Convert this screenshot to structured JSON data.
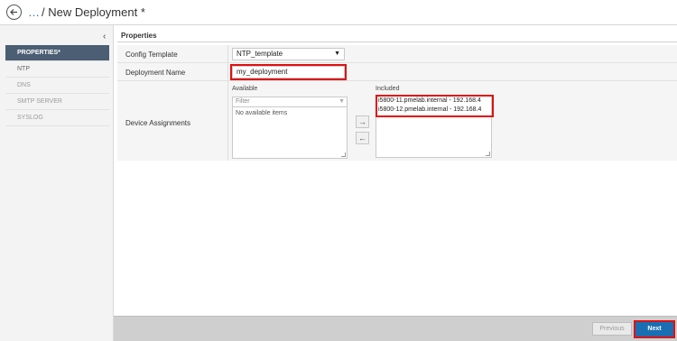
{
  "header": {
    "ellipsis": "…",
    "title": "/ New Deployment *"
  },
  "sidebar": {
    "collapse_glyph": "‹",
    "items": [
      {
        "label": "PROPERTIES*"
      },
      {
        "label": "NTP"
      },
      {
        "label": "DNS"
      },
      {
        "label": "SMTP SERVER"
      },
      {
        "label": "SYSLOG"
      }
    ]
  },
  "properties": {
    "section_title": "Properties",
    "config_template": {
      "label": "Config Template",
      "value": "NTP_template"
    },
    "deployment_name": {
      "label": "Deployment Name",
      "value": "my_deployment"
    },
    "device_assignments": {
      "label": "Device Assignments",
      "available_label": "Available",
      "filter_placeholder": "Filter",
      "empty_text": "No available items",
      "included_label": "Included",
      "included": [
        "i5800-11.pmelab.internal - 192.168.4",
        "i5800-12.pmelab.internal - 192.168.4"
      ]
    }
  },
  "footer": {
    "previous_label": "Previous",
    "next_label": "Next"
  },
  "colors": {
    "accent": "#1a6fb3",
    "active_nav": "#4b5e73",
    "highlight": "#e01010"
  }
}
